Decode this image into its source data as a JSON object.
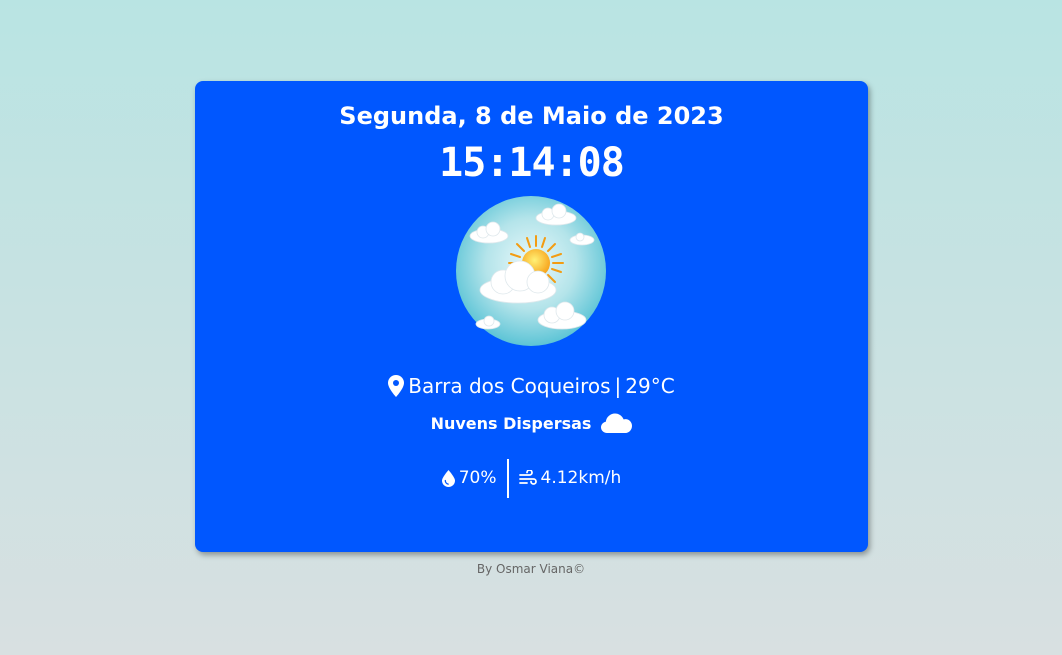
{
  "card": {
    "date": "Segunda, 8 de Maio de 2023",
    "time": "15:14:08",
    "weather_icon": "scattered-clouds-sun-icon",
    "location": "Barra dos Coqueiros",
    "separator": "|",
    "temperature": "29°C",
    "description": "Nuvens Dispersas",
    "humidity": "70%",
    "wind": "4.12km/h"
  },
  "footer": {
    "credit": "By Osmar Viana©"
  },
  "colors": {
    "card": "#0057ff",
    "background_top": "#b9e4e3",
    "background_bottom": "#d8e0e1"
  }
}
